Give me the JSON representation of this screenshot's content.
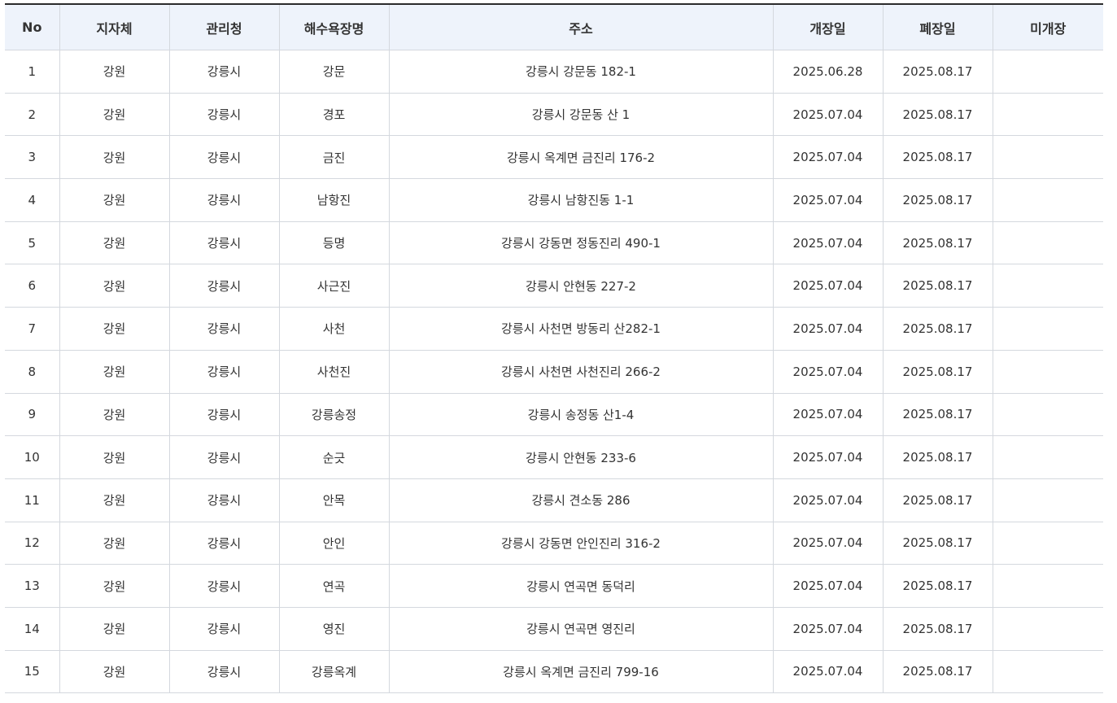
{
  "table": {
    "headers": [
      "No",
      "지자체",
      "관리청",
      "해수욕장명",
      "주소",
      "개장일",
      "폐장일",
      "미개장"
    ],
    "rows": [
      [
        "1",
        "강원",
        "강릉시",
        "강문",
        "강릉시 강문동 182-1",
        "2025.06.28",
        "2025.08.17",
        ""
      ],
      [
        "2",
        "강원",
        "강릉시",
        "경포",
        "강릉시 강문동 산 1",
        "2025.07.04",
        "2025.08.17",
        ""
      ],
      [
        "3",
        "강원",
        "강릉시",
        "금진",
        "강릉시 옥계면 금진리 176-2",
        "2025.07.04",
        "2025.08.17",
        ""
      ],
      [
        "4",
        "강원",
        "강릉시",
        "남항진",
        "강릉시 남항진동 1-1",
        "2025.07.04",
        "2025.08.17",
        ""
      ],
      [
        "5",
        "강원",
        "강릉시",
        "등명",
        "강릉시 강동면 정동진리 490-1",
        "2025.07.04",
        "2025.08.17",
        ""
      ],
      [
        "6",
        "강원",
        "강릉시",
        "사근진",
        "강릉시 안현동 227-2",
        "2025.07.04",
        "2025.08.17",
        ""
      ],
      [
        "7",
        "강원",
        "강릉시",
        "사천",
        "강릉시 사천면 방동리 산282-1",
        "2025.07.04",
        "2025.08.17",
        ""
      ],
      [
        "8",
        "강원",
        "강릉시",
        "사천진",
        "강릉시 사천면 사천진리 266-2",
        "2025.07.04",
        "2025.08.17",
        ""
      ],
      [
        "9",
        "강원",
        "강릉시",
        "강릉송정",
        "강릉시 송정동 산1-4",
        "2025.07.04",
        "2025.08.17",
        ""
      ],
      [
        "10",
        "강원",
        "강릉시",
        "순긋",
        "강릉시 안현동 233-6",
        "2025.07.04",
        "2025.08.17",
        ""
      ],
      [
        "11",
        "강원",
        "강릉시",
        "안목",
        "강릉시 견소동 286",
        "2025.07.04",
        "2025.08.17",
        ""
      ],
      [
        "12",
        "강원",
        "강릉시",
        "안인",
        "강릉시 강동면 안인진리 316-2",
        "2025.07.04",
        "2025.08.17",
        ""
      ],
      [
        "13",
        "강원",
        "강릉시",
        "연곡",
        "강릉시 연곡면 동덕리",
        "2025.07.04",
        "2025.08.17",
        ""
      ],
      [
        "14",
        "강원",
        "강릉시",
        "영진",
        "강릉시 연곡면 영진리",
        "2025.07.04",
        "2025.08.17",
        ""
      ],
      [
        "15",
        "강원",
        "강릉시",
        "강릉옥계",
        "강릉시 옥계면 금진리 799-16",
        "2025.07.04",
        "2025.08.17",
        ""
      ]
    ]
  },
  "colors": {
    "header_bg": "#eef3fb",
    "top_border": "#2b2b2b",
    "grid_line": "#d4d8de",
    "text": "#333333"
  }
}
